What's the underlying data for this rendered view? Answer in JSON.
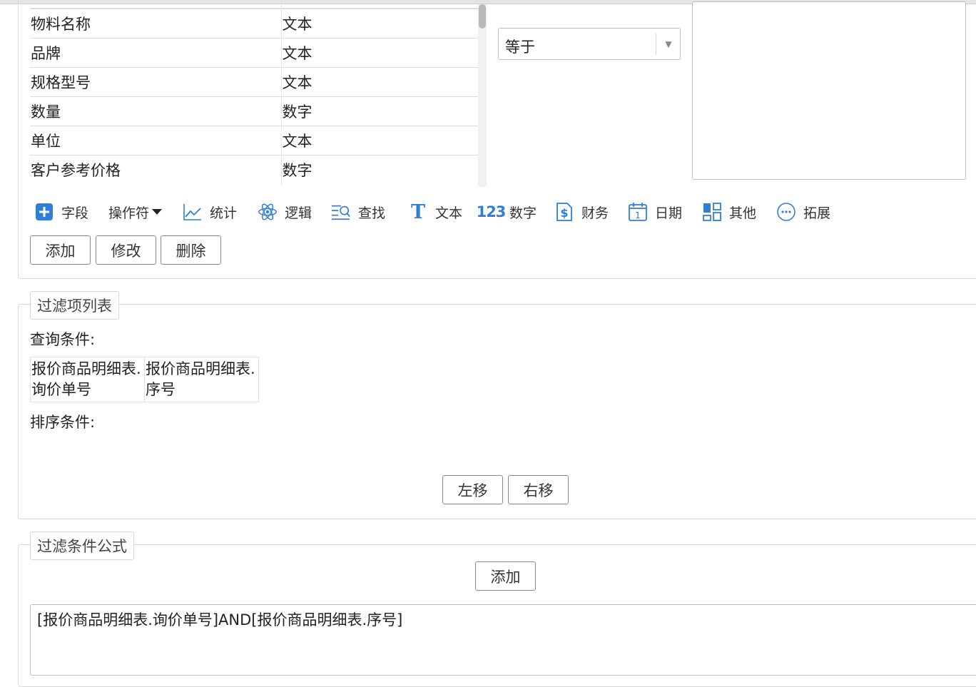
{
  "field_list": {
    "rows": [
      {
        "name": "物料名称",
        "type": "文本"
      },
      {
        "name": "品牌",
        "type": "文本"
      },
      {
        "name": "规格型号",
        "type": "文本"
      },
      {
        "name": "数量",
        "type": "数字"
      },
      {
        "name": "单位",
        "type": "文本"
      },
      {
        "name": "客户参考价格",
        "type": "数字"
      }
    ]
  },
  "operator_select": {
    "value": "等于"
  },
  "value_input": {
    "value": ""
  },
  "toolbar": {
    "items": [
      {
        "label": "字段",
        "icon": "plus-square-icon"
      },
      {
        "label": "操作符",
        "icon": "caret-down-icon"
      },
      {
        "label": "统计",
        "icon": "line-chart-icon"
      },
      {
        "label": "逻辑",
        "icon": "atom-icon"
      },
      {
        "label": "查找",
        "icon": "search-list-icon"
      },
      {
        "label": "文本",
        "icon": "text-t-icon"
      },
      {
        "label": "数字",
        "icon": "number-123-icon"
      },
      {
        "label": "财务",
        "icon": "dollar-icon"
      },
      {
        "label": "日期",
        "icon": "calendar-icon"
      },
      {
        "label": "其他",
        "icon": "grid-icon"
      },
      {
        "label": "拓展",
        "icon": "more-circle-icon"
      }
    ]
  },
  "actions": {
    "add": "添加",
    "edit": "修改",
    "delete": "删除"
  },
  "filter_list": {
    "legend": "过滤项列表",
    "query_label": "查询条件:",
    "query_items": [
      "报价商品明细表.询价单号",
      "报价商品明细表.序号"
    ],
    "sort_label": "排序条件:",
    "move_left": "左移",
    "move_right": "右移"
  },
  "filter_formula": {
    "legend": "过滤条件公式",
    "add": "添加",
    "formula": "[报价商品明细表.询价单号]AND[报价商品明细表.序号]"
  },
  "colors": {
    "accent": "#2f7fd8",
    "border": "#d8d8d8",
    "button_border": "#8a8a8a"
  }
}
